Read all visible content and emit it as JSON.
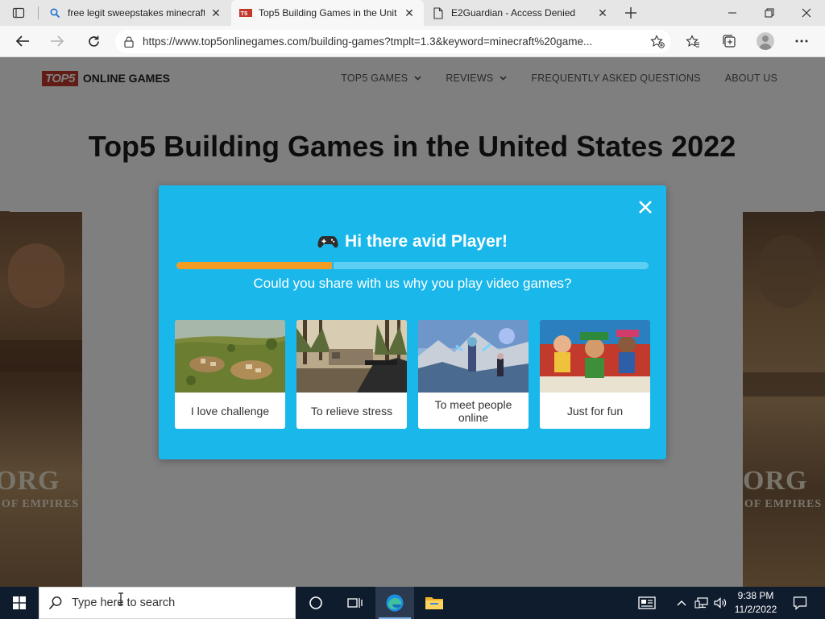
{
  "browser": {
    "tabs": [
      {
        "title": "free legit sweepstakes minecraft",
        "favicon": "search-icon",
        "active": false
      },
      {
        "title": "Top5 Building Games in the Unit",
        "favicon": "top5-favicon",
        "active": true
      },
      {
        "title": "E2Guardian - Access Denied",
        "favicon": "page-icon",
        "active": false
      }
    ],
    "url": "https://www.top5onlinegames.com/building-games?tmplt=1.3&keyword=minecraft%20game..."
  },
  "site": {
    "logo_mark": "TOP5",
    "logo_text": "ONLINE GAMES",
    "nav": [
      {
        "label": "TOP5 GAMES",
        "has_dropdown": true
      },
      {
        "label": "REVIEWS",
        "has_dropdown": true
      },
      {
        "label": "FREQUENTLY ASKED QUESTIONS",
        "has_dropdown": false
      },
      {
        "label": "ABOUT US",
        "has_dropdown": false
      }
    ],
    "headline": "Top5 Building Games in the United States 2022",
    "side_art": {
      "word": "ORG",
      "subtitle": "OF EMPIRES"
    }
  },
  "modal": {
    "title": "Hi there avid Player!",
    "title_icon": "gamepad-icon",
    "question": "Could you share with us why you play video games?",
    "progress": 0.333,
    "options": [
      {
        "label": "I love challenge",
        "image": "strategy-game-thumbnail"
      },
      {
        "label": "To relieve stress",
        "image": "shooter-game-thumbnail"
      },
      {
        "label": "To meet people online",
        "image": "fantasy-game-thumbnail"
      },
      {
        "label": "Just for fun",
        "image": "runner-game-thumbnail"
      }
    ]
  },
  "taskbar": {
    "search_placeholder": "Type here to search",
    "time": "9:38 PM",
    "date": "11/2/2022"
  },
  "colors": {
    "modal_bg": "#1ab7ea",
    "progress_fill": "#f39c23",
    "progress_track": "#5ccff2",
    "taskbar_bg": "#0f1c2e"
  }
}
